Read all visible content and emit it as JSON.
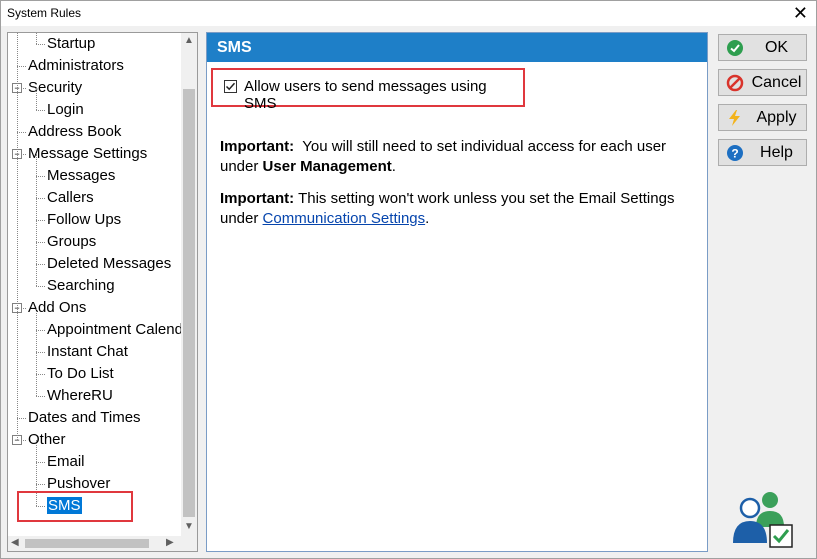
{
  "window": {
    "title": "System Rules",
    "close_symbol": "✕"
  },
  "tree": {
    "nodes": [
      {
        "label": "Startup",
        "level": 2
      },
      {
        "label": "Administrators",
        "level": 1
      },
      {
        "label": "Security",
        "level": 1,
        "expanded": true
      },
      {
        "label": "Login",
        "level": 2
      },
      {
        "label": "Address Book",
        "level": 1
      },
      {
        "label": "Message Settings",
        "level": 1,
        "expanded": true
      },
      {
        "label": "Messages",
        "level": 2
      },
      {
        "label": "Callers",
        "level": 2
      },
      {
        "label": "Follow Ups",
        "level": 2
      },
      {
        "label": "Groups",
        "level": 2
      },
      {
        "label": "Deleted Messages",
        "level": 2
      },
      {
        "label": "Searching",
        "level": 2
      },
      {
        "label": "Add Ons",
        "level": 1,
        "expanded": true
      },
      {
        "label": "Appointment Calendar",
        "level": 2
      },
      {
        "label": "Instant Chat",
        "level": 2
      },
      {
        "label": "To Do List",
        "level": 2
      },
      {
        "label": "WhereRU",
        "level": 2
      },
      {
        "label": "Dates and Times",
        "level": 1
      },
      {
        "label": "Other",
        "level": 1,
        "expanded": true
      },
      {
        "label": "Email",
        "level": 2
      },
      {
        "label": "Pushover",
        "level": 2
      },
      {
        "label": "SMS",
        "level": 2,
        "selected": true
      }
    ],
    "toggle_symbol": "−"
  },
  "panel": {
    "header": "SMS",
    "checkbox": {
      "label": "Allow users to send messages using SMS",
      "checked": true
    },
    "para1": {
      "bold": "Important:",
      "text": "  You will still need to set individual access for each user under ",
      "bold2": "User Management",
      "end": "."
    },
    "para2": {
      "bold": "Important:",
      "text": " This setting won't work unless you set the Email Settings under ",
      "link": "Communication Settings",
      "end": "."
    }
  },
  "buttons": {
    "ok": "OK",
    "cancel": "Cancel",
    "apply": "Apply",
    "help": "Help"
  },
  "colors": {
    "header_bg": "#1e7fc8",
    "selection": "#0078d7",
    "highlight_border": "#e0383e",
    "link": "#0645ad"
  }
}
